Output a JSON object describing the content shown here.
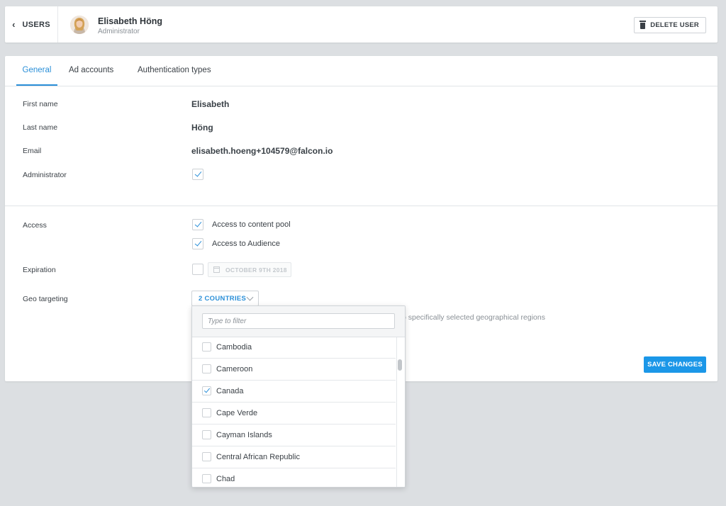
{
  "header": {
    "back_label": "USERS",
    "user_name": "Elisabeth Höng",
    "user_role": "Administrator",
    "delete_label": "DELETE USER"
  },
  "tabs": [
    {
      "label": "General",
      "active": true
    },
    {
      "label": "Ad accounts",
      "active": false
    },
    {
      "label": "Authentication types",
      "active": false
    }
  ],
  "general": {
    "first_name_label": "First name",
    "first_name": "Elisabeth",
    "last_name_label": "Last name",
    "last_name": "Höng",
    "email_label": "Email",
    "email": "elisabeth.hoeng+104579@falcon.io",
    "administrator_label": "Administrator",
    "administrator_checked": true
  },
  "access": {
    "label": "Access",
    "options": [
      {
        "label": "Access to content pool",
        "checked": true
      },
      {
        "label": "Access to Audience",
        "checked": true
      }
    ],
    "expiration_label": "Expiration",
    "expiration_checked": false,
    "expiration_date": "OCTOBER 9TH 2018",
    "geo_label": "Geo targeting",
    "geo_button": "2 COUNTRIES",
    "geo_hint": "o specifically selected geographical regions"
  },
  "save_label": "SAVE CHANGES",
  "dropdown": {
    "filter_placeholder": "Type to filter",
    "items": [
      {
        "name": "Cambodia",
        "checked": false
      },
      {
        "name": "Cameroon",
        "checked": false
      },
      {
        "name": "Canada",
        "checked": true
      },
      {
        "name": "Cape Verde",
        "checked": false
      },
      {
        "name": "Cayman Islands",
        "checked": false
      },
      {
        "name": "Central African Republic",
        "checked": false
      },
      {
        "name": "Chad",
        "checked": false
      }
    ]
  },
  "colors": {
    "accent": "#2a8fd8",
    "primary_button": "#1b97e8",
    "background": "#dcdfe2"
  }
}
